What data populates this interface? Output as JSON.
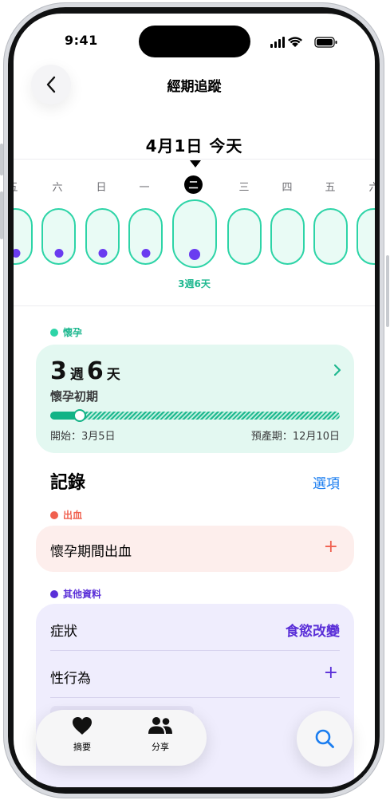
{
  "status": {
    "time": "9:41"
  },
  "nav": {
    "title": "經期追蹤"
  },
  "date_header": {
    "date": "4月1日 今天"
  },
  "weekdays": [
    {
      "label": "五"
    },
    {
      "label": "六"
    },
    {
      "label": "日"
    },
    {
      "label": "一"
    },
    {
      "label": "二",
      "selected": true
    },
    {
      "label": "三"
    },
    {
      "label": "四"
    },
    {
      "label": "五"
    },
    {
      "label": "六"
    }
  ],
  "day_pills": [
    {
      "logged": true
    },
    {
      "logged": true
    },
    {
      "logged": true
    },
    {
      "logged": true
    },
    {
      "logged": true,
      "selected": true
    },
    {
      "logged": false
    },
    {
      "logged": false
    },
    {
      "logged": false
    },
    {
      "logged": false
    }
  ],
  "selected_week_label": "3週6天",
  "pregnancy": {
    "section_label": "懷孕",
    "weeks": "3",
    "weeks_unit": "週",
    "days": "6",
    "days_unit": "天",
    "stage": "懷孕初期",
    "progress": 0.1,
    "start": "開始：3月5日",
    "due": "預產期：12月10日"
  },
  "records": {
    "title": "記錄",
    "options": "選項"
  },
  "bleeding": {
    "section_label": "出血",
    "item": "懷孕期間出血",
    "add": "+"
  },
  "other": {
    "section_label": "其他資料",
    "rows": [
      {
        "label": "症狀",
        "value": "食慾改變"
      },
      {
        "label": "性行為",
        "value": "+"
      }
    ]
  },
  "tabbar": {
    "summary": "摘要",
    "share": "分享"
  },
  "colors": {
    "pregnancy": "#1fb890",
    "bleeding": "#f0604f",
    "other": "#5a2fd8",
    "link": "#1a7df0"
  }
}
